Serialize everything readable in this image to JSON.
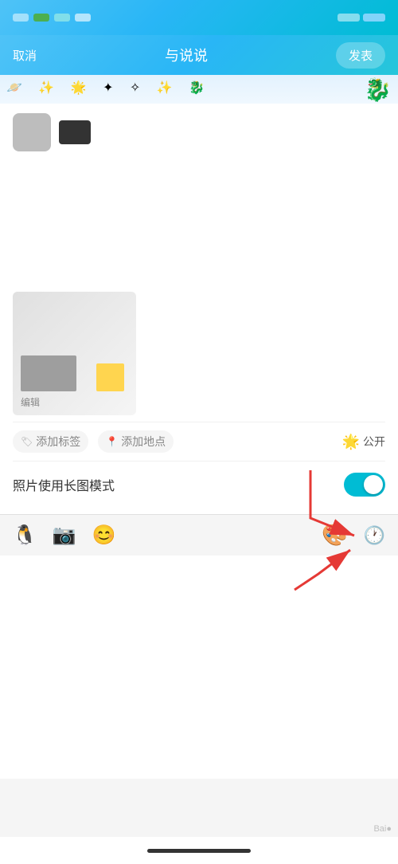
{
  "statusBar": {
    "dots": [
      "gray",
      "green",
      "teal",
      "light-blue",
      "gray",
      "light-blue"
    ]
  },
  "navBar": {
    "backLabel": "取消",
    "title": "与说说",
    "actionLabel": "发表"
  },
  "tags": {
    "addTagLabel": "添加标签",
    "addLocationLabel": "添加地点",
    "privacyLabel": "公开"
  },
  "longImageMode": {
    "label": "照片使用长图模式"
  },
  "bottomToolbar": {
    "icons": [
      "🐧",
      "📷",
      "😊"
    ]
  },
  "watermark": "Bai●"
}
